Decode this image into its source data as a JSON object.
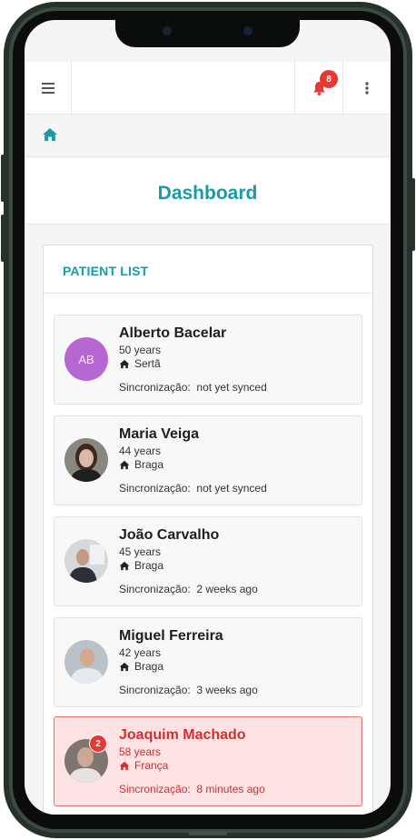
{
  "topbar": {
    "notification_count": "8"
  },
  "page": {
    "title": "Dashboard"
  },
  "panel": {
    "title": "PATIENT LIST"
  },
  "sync_label": "Sincronização:",
  "patients": [
    {
      "name": "Alberto Bacelar",
      "initials": "AB",
      "age": "50 years",
      "location": "Sertã",
      "sync": "not yet synced",
      "alert": false
    },
    {
      "name": "Maria Veiga",
      "age": "44 years",
      "location": "Braga",
      "sync": "not yet synced",
      "alert": false
    },
    {
      "name": "João Carvalho",
      "age": "45 years",
      "location": "Braga",
      "sync": "2 weeks ago",
      "alert": false
    },
    {
      "name": "Miguel Ferreira",
      "age": "42 years",
      "location": "Braga",
      "sync": "3 weeks ago",
      "alert": false
    },
    {
      "name": "Joaquim Machado",
      "age": "58 years",
      "location": "França",
      "sync": "8 minutes ago",
      "alert": true,
      "alert_count": "2"
    }
  ],
  "colors": {
    "accent": "#1a9aa8",
    "alert": "#d32f2f",
    "badge": "#e53935",
    "avatar_initials_bg": "#b767d1"
  }
}
